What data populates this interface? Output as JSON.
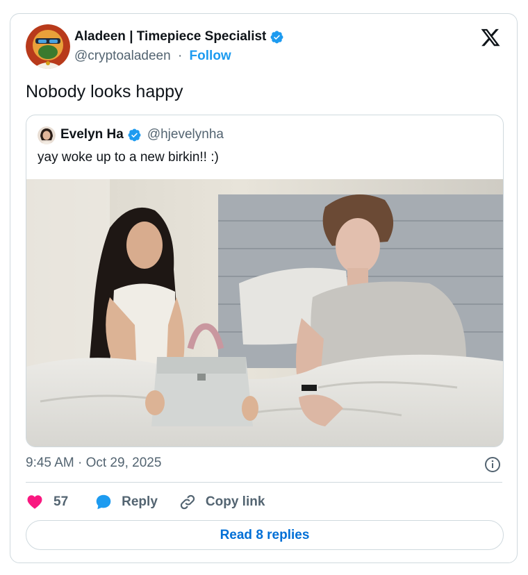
{
  "author": {
    "name": "Aladeen | Timepiece Specialist",
    "handle": "@cryptoaladeen",
    "separator": "·",
    "follow_label": "Follow"
  },
  "tweet": {
    "text": "Nobody looks happy",
    "timestamp": "9:45 AM · Oct 29, 2025"
  },
  "quoted": {
    "name": "Evelyn Ha",
    "handle": "@hjevelynha",
    "text": "yay woke up to a new birkin!! :)"
  },
  "actions": {
    "likes": "57",
    "reply_label": "Reply",
    "copy_label": "Copy link",
    "read_replies_label": "Read 8 replies"
  },
  "colors": {
    "accent": "#1d9bf0",
    "like": "#f91880",
    "link": "#006fd6",
    "muted": "#536471",
    "border": "#cfd9de"
  },
  "icons": [
    "verified-badge-icon",
    "x-logo-icon",
    "info-icon",
    "heart-icon",
    "reply-bubble-icon",
    "link-icon"
  ]
}
